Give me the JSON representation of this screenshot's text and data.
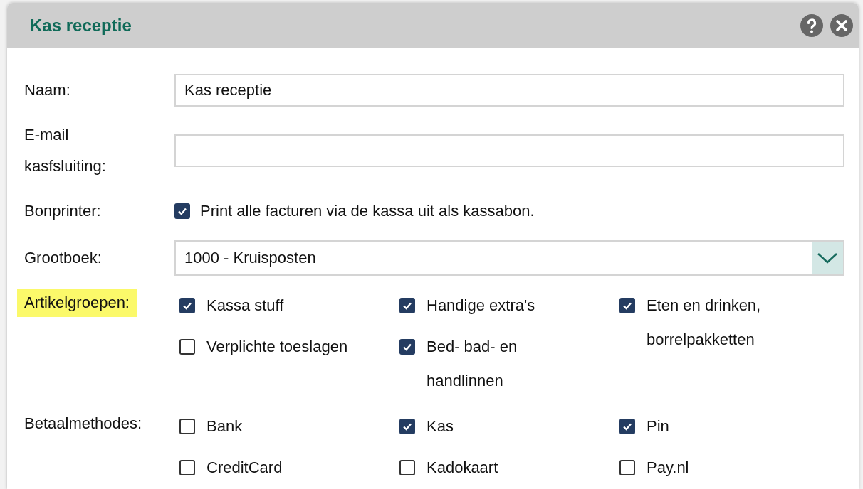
{
  "window": {
    "title": "Kas receptie"
  },
  "fields": [
    {
      "kind": "text",
      "label": "Naam:",
      "value": "Kas receptie"
    },
    {
      "kind": "text",
      "label": "E-mail kasfsluiting:"
    },
    {
      "kind": "checkbox",
      "label": "Bonprinter:",
      "text": "Print alle facturen via de kassa uit als kassabon.",
      "checked": true
    },
    {
      "kind": "select",
      "label": "Grootboek:",
      "value": "1000 - Kruisposten"
    },
    {
      "kind": "checkgroup",
      "label": "Artikelgroepen:",
      "highlighted": true,
      "columns": [
        [
          {
            "label": "Kassa stuff",
            "checked": true
          },
          {
            "label": "Verplichte toeslagen",
            "checked": false
          }
        ],
        [
          {
            "label": "Handige extra's",
            "checked": true
          },
          {
            "label": "Bed- bad- en handlinnen",
            "checked": true
          }
        ],
        [
          {
            "label": "Eten en drinken, borrelpakketten",
            "checked": true
          }
        ]
      ]
    },
    {
      "kind": "checkgroup",
      "label": "Betaalmethodes:",
      "highlighted": false,
      "columns": [
        [
          {
            "label": "Bank",
            "checked": false
          },
          {
            "label": "CreditCard",
            "checked": false
          }
        ],
        [
          {
            "label": "Kas",
            "checked": true
          },
          {
            "label": "Kadokaart",
            "checked": false
          }
        ],
        [
          {
            "label": "Pin",
            "checked": true
          },
          {
            "label": "Pay.nl",
            "checked": false
          }
        ]
      ]
    }
  ]
}
